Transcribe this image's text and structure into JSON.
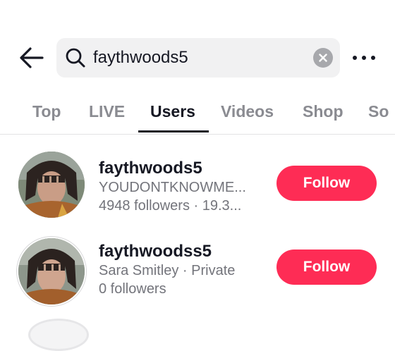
{
  "search": {
    "query": "faythwoods5"
  },
  "icons": {
    "back": "arrow-left-icon",
    "search": "search-icon",
    "clear": "clear-x-icon",
    "more": "more-horizontal-icon"
  },
  "tabs": [
    {
      "label": "Top",
      "active": false
    },
    {
      "label": "LIVE",
      "active": false
    },
    {
      "label": "Users",
      "active": true
    },
    {
      "label": "Videos",
      "active": false
    },
    {
      "label": "Shop",
      "active": false
    },
    {
      "label": "So",
      "active": false
    }
  ],
  "users": [
    {
      "username": "faythwoods5",
      "line1": "YOUDONTKNOWME...",
      "line2": "4948 followers · 19.3...",
      "follow_label": "Follow"
    },
    {
      "username": "faythwoodss5",
      "line1": "Sara Smitley · Private",
      "line2": "0 followers",
      "follow_label": "Follow"
    }
  ],
  "colors": {
    "accent": "#fe2c55",
    "text": "#161823",
    "muted": "#73747b",
    "tab_inactive": "#8a8b91",
    "search_bg": "#f1f1f2"
  }
}
